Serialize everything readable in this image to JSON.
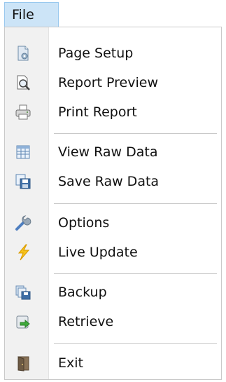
{
  "menu_bar": {
    "file_label": "File"
  },
  "menu": {
    "items": [
      {
        "label": "Page Setup",
        "icon": "page-setup-icon"
      },
      {
        "label": "Report Preview",
        "icon": "report-preview-icon"
      },
      {
        "label": "Print Report",
        "icon": "printer-icon"
      },
      {
        "label": "View Raw Data",
        "icon": "table-icon"
      },
      {
        "label": "Save Raw Data",
        "icon": "save-icon"
      },
      {
        "label": "Options",
        "icon": "wrench-icon"
      },
      {
        "label": "Live Update",
        "icon": "lightning-icon"
      },
      {
        "label": "Backup",
        "icon": "backup-icon"
      },
      {
        "label": "Retrieve",
        "icon": "retrieve-icon"
      },
      {
        "label": "Exit",
        "icon": "exit-door-icon"
      }
    ]
  },
  "colors": {
    "tab_highlight": "#cce4f7",
    "tab_border": "#99c8ee",
    "icon_strip": "#f1f1f1",
    "separator": "#c9c9c9"
  }
}
